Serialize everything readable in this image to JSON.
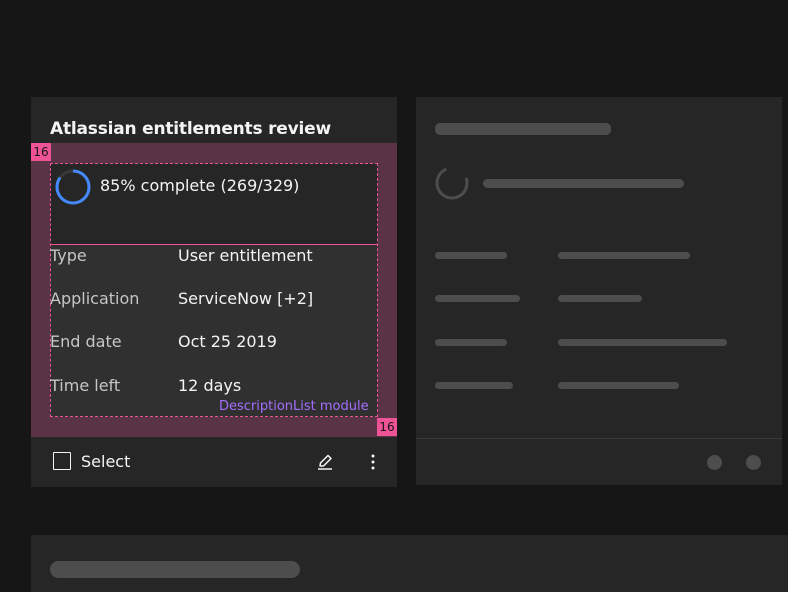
{
  "card": {
    "title": "Atlassian entitlements review",
    "progress": {
      "percent_complete": 85,
      "text": "85% complete (269/329)",
      "accent_color": "#4589ff"
    },
    "description_list": [
      {
        "term": "Type",
        "description": "User entitlement"
      },
      {
        "term": "Application",
        "description": "ServiceNow [+2]"
      },
      {
        "term": "End date",
        "description": "Oct 25 2019"
      },
      {
        "term": "Time left",
        "description": "12 days"
      }
    ],
    "footer": {
      "select_label": "Select",
      "edit_icon": "edit-icon",
      "more_icon": "overflow-menu-icon"
    }
  },
  "annotations": {
    "spacing_top_left": "16",
    "spacing_bottom_right": "16",
    "module_label": "DescriptionList module",
    "highlight_color": "#ee5396",
    "label_color": "#a56eff"
  }
}
